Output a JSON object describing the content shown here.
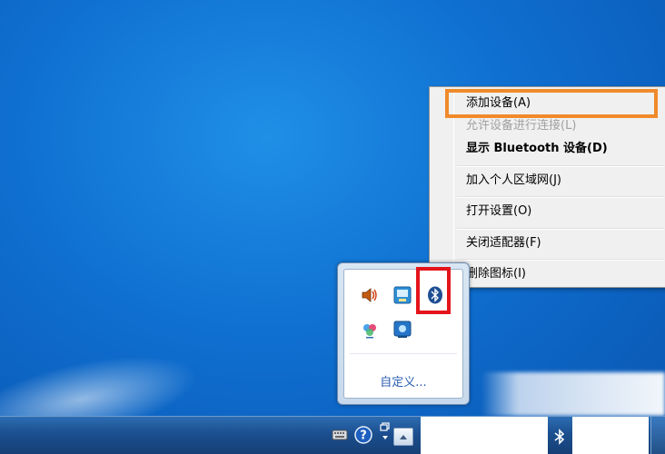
{
  "context_menu": {
    "items": [
      {
        "label": "添加设备(A)",
        "state": "highlighted"
      },
      {
        "label": "允许设备进行连接(L)",
        "state": "disabled"
      },
      {
        "label": "显示 Bluetooth 设备(D)",
        "state": "default-bold"
      },
      {
        "label": "加入个人区域网(J)",
        "state": "normal"
      },
      {
        "label": "打开设置(O)",
        "state": "normal"
      },
      {
        "label": "关闭适配器(F)",
        "state": "normal"
      },
      {
        "label": "删除图标(I)",
        "state": "normal"
      }
    ]
  },
  "tray_panel": {
    "icons": [
      "speaker-icon",
      "network-monitor-icon",
      "bluetooth-icon",
      "color-flower-icon",
      "display-icon"
    ],
    "customize_label": "自定义..."
  },
  "taskbar": {
    "icons": [
      "keyboard-icon",
      "help-icon",
      "action-center-icon",
      "show-hidden-icons-arrow",
      "bluetooth-small-icon"
    ]
  },
  "colors": {
    "highlight_orange": "#f08a2a",
    "highlight_red": "#e4141b",
    "desktop_blue": "#0f6fd0",
    "link_blue": "#2a5db0"
  }
}
